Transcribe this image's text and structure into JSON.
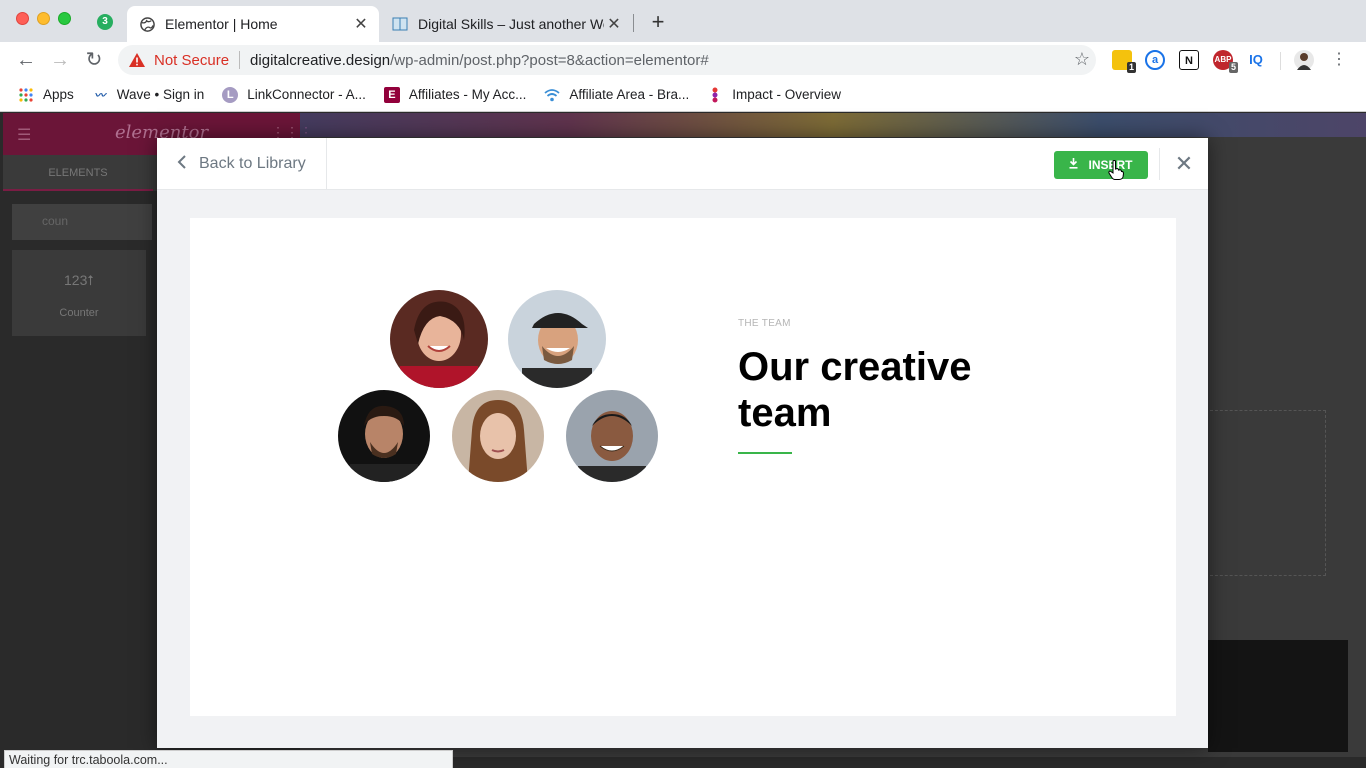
{
  "browser": {
    "extension_badge": "3",
    "tabs": [
      {
        "title": "Elementor | Home",
        "active": true
      },
      {
        "title": "Digital Skills – Just another Wo",
        "active": false
      }
    ],
    "url": {
      "security_label": "Not Secure",
      "domain": "digitalcreative.design",
      "path": "/wp-admin/post.php?post=8&action=elementor#"
    },
    "extensions": [
      {
        "name": "ext-badge-1",
        "badge": "1"
      },
      {
        "name": "ext-a",
        "label": "a"
      },
      {
        "name": "ext-n",
        "label": "N"
      },
      {
        "name": "ext-abp",
        "label": "ABP",
        "badge": "5"
      },
      {
        "name": "ext-iq",
        "label": "IQ"
      }
    ],
    "bookmarks": [
      {
        "label": "Apps"
      },
      {
        "label": "Wave • Sign in"
      },
      {
        "label": "LinkConnector - A..."
      },
      {
        "label": "Affiliates - My Acc..."
      },
      {
        "label": "Affiliate Area - Bra..."
      },
      {
        "label": "Impact - Overview"
      }
    ],
    "status_text": "Waiting for trc.taboola.com..."
  },
  "editor": {
    "logo": "elementor",
    "panel_tab": "ELEMENTS",
    "search_value": "coun",
    "widget": {
      "icon_text": "123",
      "label": "Counter"
    }
  },
  "modal": {
    "back_label": "Back to Library",
    "insert_label": "INSERT",
    "close_symbol": "✕",
    "template": {
      "eyebrow": "THE TEAM",
      "headline": "Our creative team",
      "accent_color": "#39b54a"
    }
  },
  "colors": {
    "insert_green": "#39b54a",
    "elementor_maroon": "#6b1538",
    "not_secure_red": "#d93025"
  }
}
